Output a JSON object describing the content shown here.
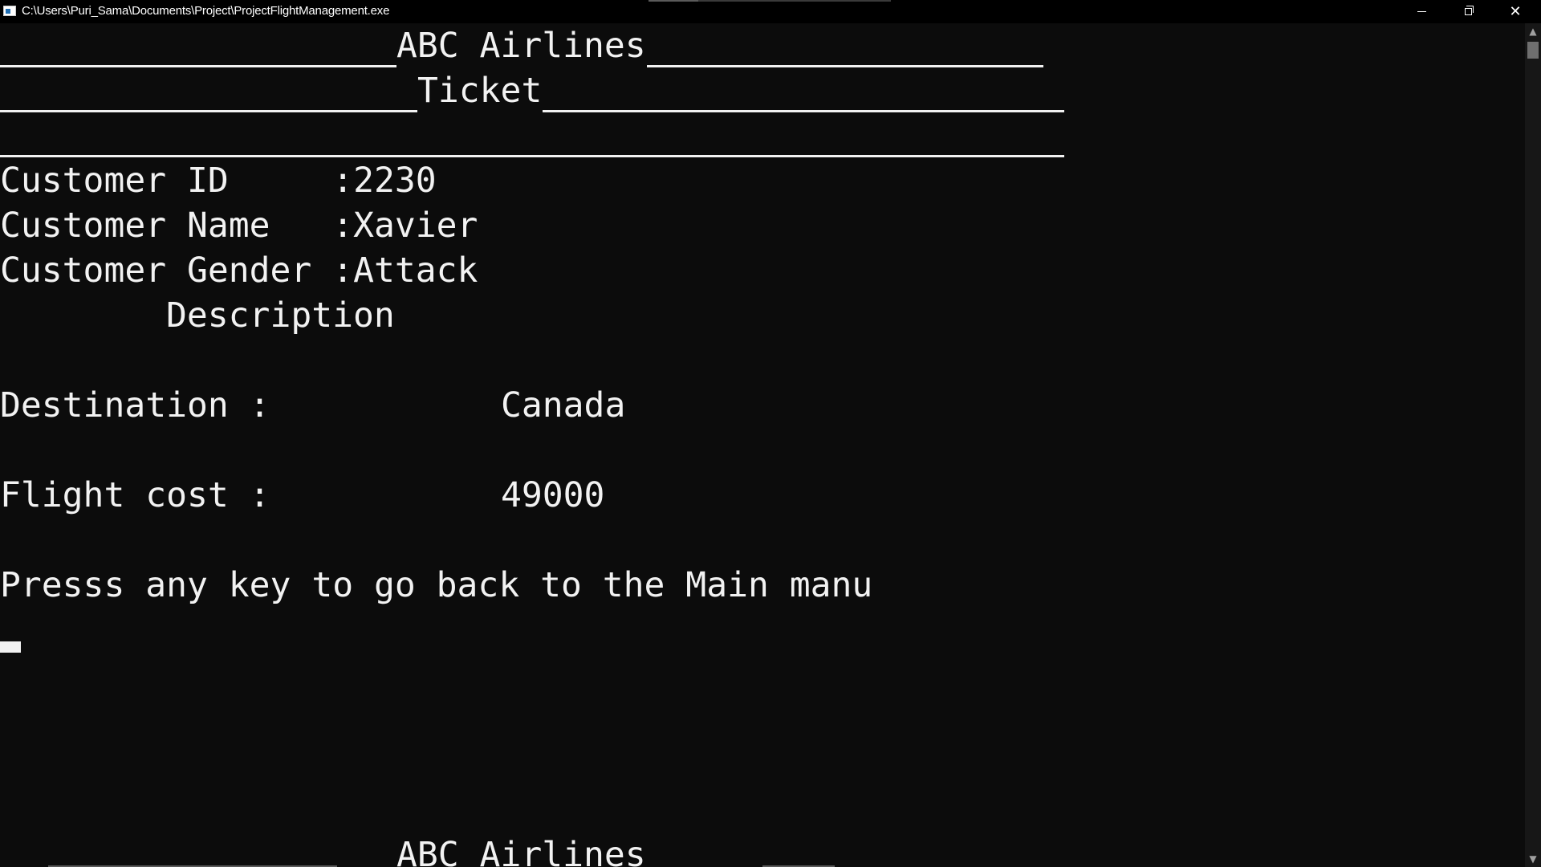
{
  "window": {
    "title": "C:\\Users\\Puri_Sama\\Documents\\Project\\ProjectFlightManagement.exe",
    "icon": "console-app-icon",
    "controls": {
      "minimize": "minimize-icon",
      "maximize": "restore-icon",
      "close": "close-icon",
      "close_glyph": "✕"
    }
  },
  "console": {
    "header": {
      "airline": "ABC Airlines",
      "ticket": "Ticket"
    },
    "customer": {
      "id_label": "Customer ID     :",
      "id_value": "2230",
      "name_label": "Customer Name   :",
      "name_value": "Xavier",
      "gender_label": "Customer Gender :",
      "gender_value": "Attack"
    },
    "description_heading": "Description",
    "destination": {
      "label": "Destination :",
      "value": "Canada"
    },
    "flight_cost": {
      "label": "Flight cost :",
      "value": "49000"
    },
    "prompt": "Presss any key to go back to the Main manu",
    "footer_airline": "ABC Airlines"
  },
  "scrollbar": {
    "up": "▲",
    "down": "▼"
  }
}
